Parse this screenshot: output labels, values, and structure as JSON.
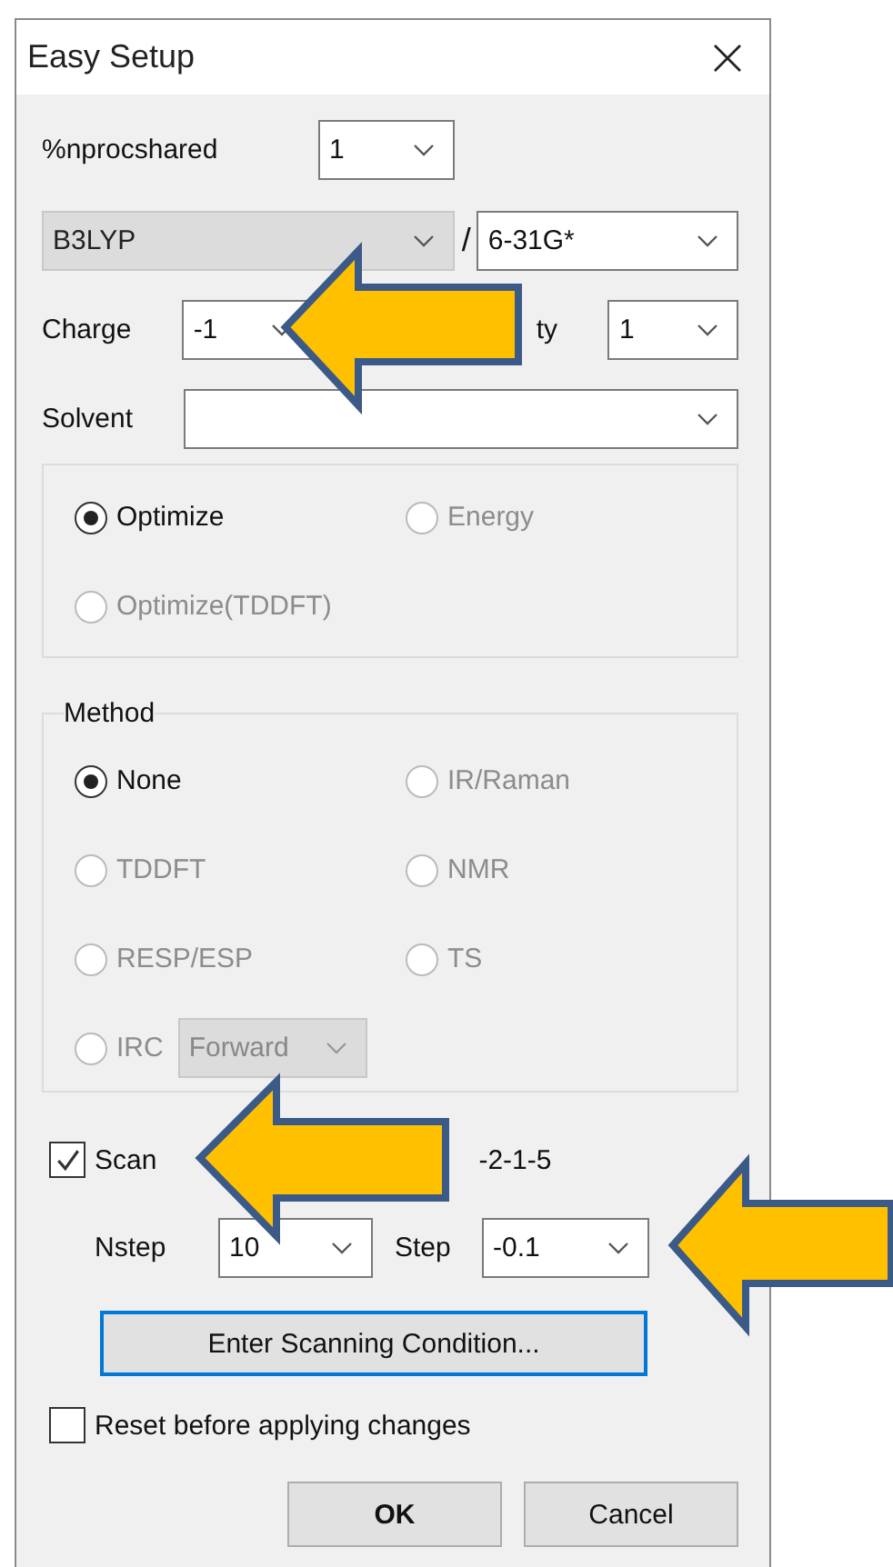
{
  "window": {
    "title": "Easy Setup"
  },
  "nprocshared": {
    "label": "%nprocshared",
    "value": "1"
  },
  "theory": {
    "functional": {
      "value": "B3LYP",
      "disabled": true
    },
    "separator": "/",
    "basis": {
      "value": "6-31G*",
      "disabled": false
    }
  },
  "charge": {
    "label": "Charge",
    "value": "-1"
  },
  "multiplicity": {
    "label": "ty",
    "value": "1"
  },
  "solvent": {
    "label": "Solvent"
  },
  "job_types": [
    {
      "label": "Optimize",
      "selected": true,
      "disabled": false
    },
    {
      "label": "Energy",
      "selected": false,
      "disabled": true
    },
    {
      "label": "Optimize(TDDFT)",
      "selected": false,
      "disabled": true
    }
  ],
  "method": {
    "title": "Method",
    "options": [
      {
        "kind": "radio",
        "label": "None",
        "selected": true,
        "disabled": false
      },
      {
        "kind": "radio",
        "label": "IR/Raman",
        "selected": false,
        "disabled": true
      },
      {
        "kind": "radio",
        "label": "TDDFT",
        "selected": false,
        "disabled": true
      },
      {
        "kind": "radio",
        "label": "NMR",
        "selected": false,
        "disabled": true
      },
      {
        "kind": "radio",
        "label": "RESP/ESP",
        "selected": false,
        "disabled": true
      },
      {
        "kind": "radio",
        "label": "TS",
        "selected": false,
        "disabled": true
      },
      {
        "kind": "radio_combo",
        "label": "IRC",
        "selected": false,
        "disabled": true,
        "combo": {
          "value": "Forward",
          "disabled": true
        }
      }
    ]
  },
  "scan": {
    "label": "Scan",
    "checked": true,
    "coordinate": "-2-1-5",
    "nstep": {
      "label": "Nstep",
      "value": "10"
    },
    "step": {
      "label": "Step",
      "value": "-0.1"
    },
    "button": {
      "label": "Enter Scanning Condition...",
      "focused": true
    }
  },
  "reset": {
    "label": "Reset before applying changes",
    "checked": false
  },
  "buttons": [
    {
      "label": "OK",
      "default": true
    },
    {
      "label": "Cancel",
      "default": false
    }
  ]
}
